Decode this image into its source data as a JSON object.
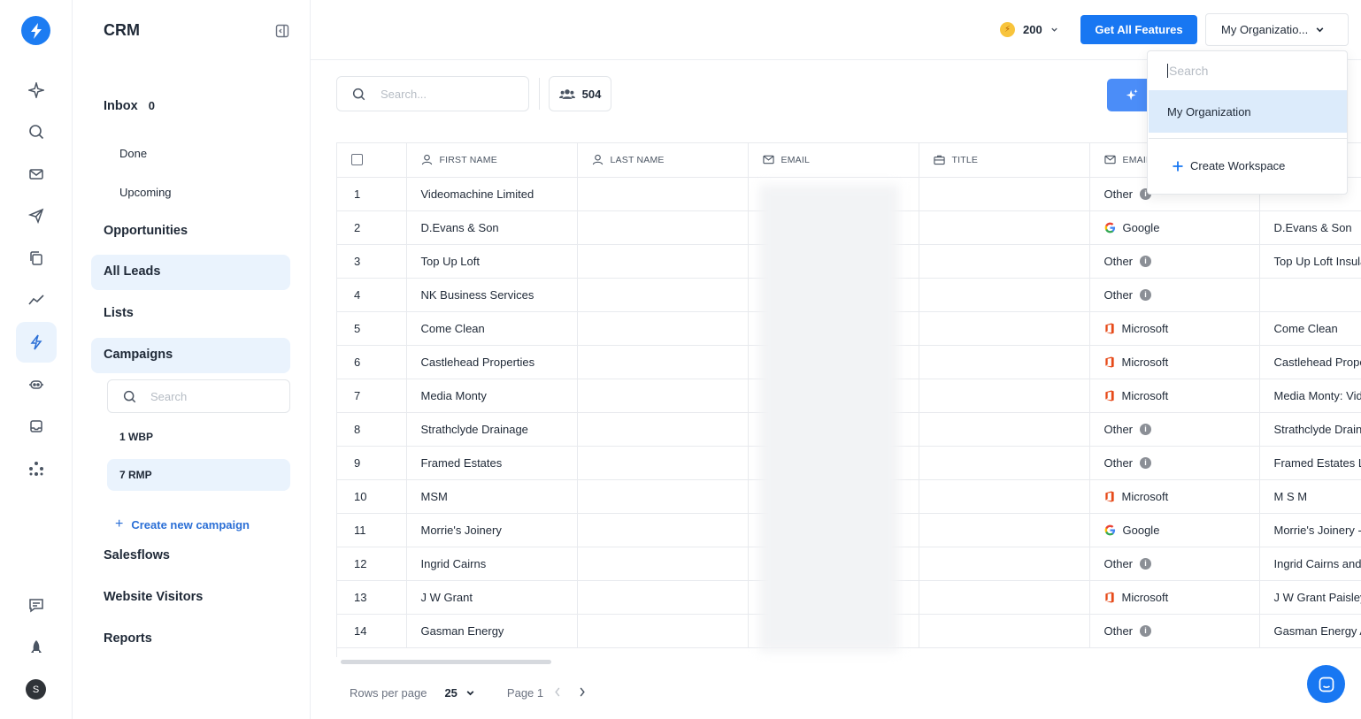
{
  "sidebar": {
    "title": "CRM",
    "inbox_label": "Inbox",
    "inbox_count": "0",
    "done": "Done",
    "upcoming": "Upcoming",
    "opportunities": "Opportunities",
    "all_leads": "All Leads",
    "lists": "Lists",
    "campaigns": "Campaigns",
    "campaign_search_placeholder": "Search",
    "campaign_items": [
      "1 WBP",
      "7 RMP"
    ],
    "create_campaign": "Create new campaign",
    "salesflows": "Salesflows",
    "website_visitors": "Website Visitors",
    "reports": "Reports"
  },
  "rail": {
    "icons": [
      "sparkle-icon",
      "search-icon",
      "mail-icon",
      "send-icon",
      "copy-icon",
      "trend-icon",
      "bolt-icon",
      "robot-icon",
      "inbox-icon",
      "apps-icon"
    ],
    "bottom_icons": [
      "feedback-icon",
      "rocket-icon"
    ],
    "avatar_initial": "S",
    "accent": "#1c7cf2"
  },
  "header": {
    "credits": "200",
    "get_features": "Get All Features",
    "org_selected": "My Organizatio..."
  },
  "toolbar": {
    "search_placeholder": "Search...",
    "lead_count": "504"
  },
  "table": {
    "columns": [
      "FIRST NAME",
      "LAST NAME",
      "EMAIL",
      "TITLE",
      "EMAIL"
    ],
    "rows": [
      {
        "idx": "1",
        "first": "Videomachine Limited",
        "provider": "Other",
        "company": ""
      },
      {
        "idx": "2",
        "first": "D.Evans & Son",
        "provider": "Google",
        "company": "D.Evans & Son"
      },
      {
        "idx": "3",
        "first": "Top Up Loft",
        "provider": "Other",
        "company": "Top Up Loft Insula"
      },
      {
        "idx": "4",
        "first": "NK Business Services",
        "provider": "Other",
        "company": ""
      },
      {
        "idx": "5",
        "first": "Come Clean",
        "provider": "Microsoft",
        "company": "Come Clean"
      },
      {
        "idx": "6",
        "first": "Castlehead Properties",
        "provider": "Microsoft",
        "company": "Castlehead Prope"
      },
      {
        "idx": "7",
        "first": "Media Monty",
        "provider": "Microsoft",
        "company": "Media Monty: Vid"
      },
      {
        "idx": "8",
        "first": "Strathclyde Drainage",
        "provider": "Other",
        "company": "Strathclyde Drain"
      },
      {
        "idx": "9",
        "first": "Framed Estates",
        "provider": "Other",
        "company": "Framed Estates L"
      },
      {
        "idx": "10",
        "first": "MSM",
        "provider": "Microsoft",
        "company": "M S M"
      },
      {
        "idx": "11",
        "first": "Morrie's Joinery",
        "provider": "Google",
        "company": "Morrie's Joinery -"
      },
      {
        "idx": "12",
        "first": "Ingrid Cairns",
        "provider": "Other",
        "company": "Ingrid Cairns and"
      },
      {
        "idx": "13",
        "first": "J W Grant",
        "provider": "Microsoft",
        "company": "J W Grant Paisley"
      },
      {
        "idx": "14",
        "first": "Gasman Energy",
        "provider": "Other",
        "company": "Gasman Energy A"
      }
    ]
  },
  "footer": {
    "rows_per_page_label": "Rows per page",
    "rows_per_page": "25",
    "page_label": "Page 1"
  },
  "org_dropdown": {
    "search_placeholder": "Search",
    "item": "My Organization",
    "create": "Create Workspace"
  }
}
